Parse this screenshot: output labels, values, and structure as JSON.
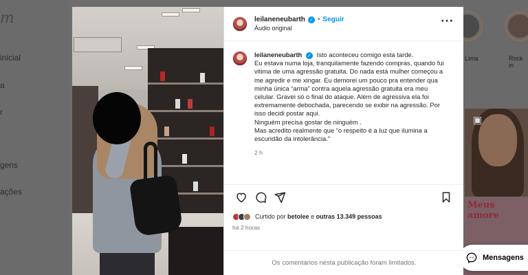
{
  "background": {
    "logo": "m",
    "nav_items": [
      "Página inicial",
      "Pesquisa",
      "Explorar",
      "Mensagens",
      "Notificações"
    ],
    "nav_visible": [
      "inicial",
      "a",
      "r",
      "gens",
      "ações"
    ],
    "stories": [
      {
        "label": "Lima"
      },
      {
        "label": "Rock in"
      }
    ],
    "reel_text": "Meus amore",
    "messages_label": "Mensagens"
  },
  "post": {
    "username": "leilaneneubarth",
    "follow_label": "Seguir",
    "audio_label": "Áudio original",
    "caption_lines": [
      "Isto aconteceu comigo esta tarde.",
      "Eu estava numa loja, tranquilamente fazendo compras, quando fui",
      "vitima de uma agressão gratuita. Do nada está mulher começou a",
      "me agredir e me xingar. Eu demorei um pouco pra entender qua",
      "minha única “arma” contra aquela agressão gratuita era meu",
      "celular. Gravei só o final do ataque. Além de agressiva ela foi",
      "extremamente debochada, parecendo se exibir na agressão. Por",
      "isso decidi postar aqui.",
      "Ninguém precisa gostar de ninguém .",
      "Mas acredito realmente que “o respeito é a luz que ilumina a",
      "escuridão da intolerância.”"
    ],
    "caption_time": "2 h",
    "liked_by_prefix": "Curtido por",
    "liked_by_user": "betolee",
    "liked_by_joiner": "e",
    "liked_by_others": "outras 13.349 pessoas",
    "posted_ago": "há 2 horas",
    "comments_limited": "Os comentários nesta publicação foram limitados."
  },
  "icons": {
    "like": "heart-icon",
    "comment": "comment-icon",
    "share": "share-icon",
    "save": "bookmark-icon",
    "more": "more-options-icon",
    "verified": "verified-badge-icon"
  },
  "colors": {
    "link_blue": "#0095f6",
    "text": "#262626",
    "muted": "#737373",
    "overlay": "#6e6e6e"
  }
}
